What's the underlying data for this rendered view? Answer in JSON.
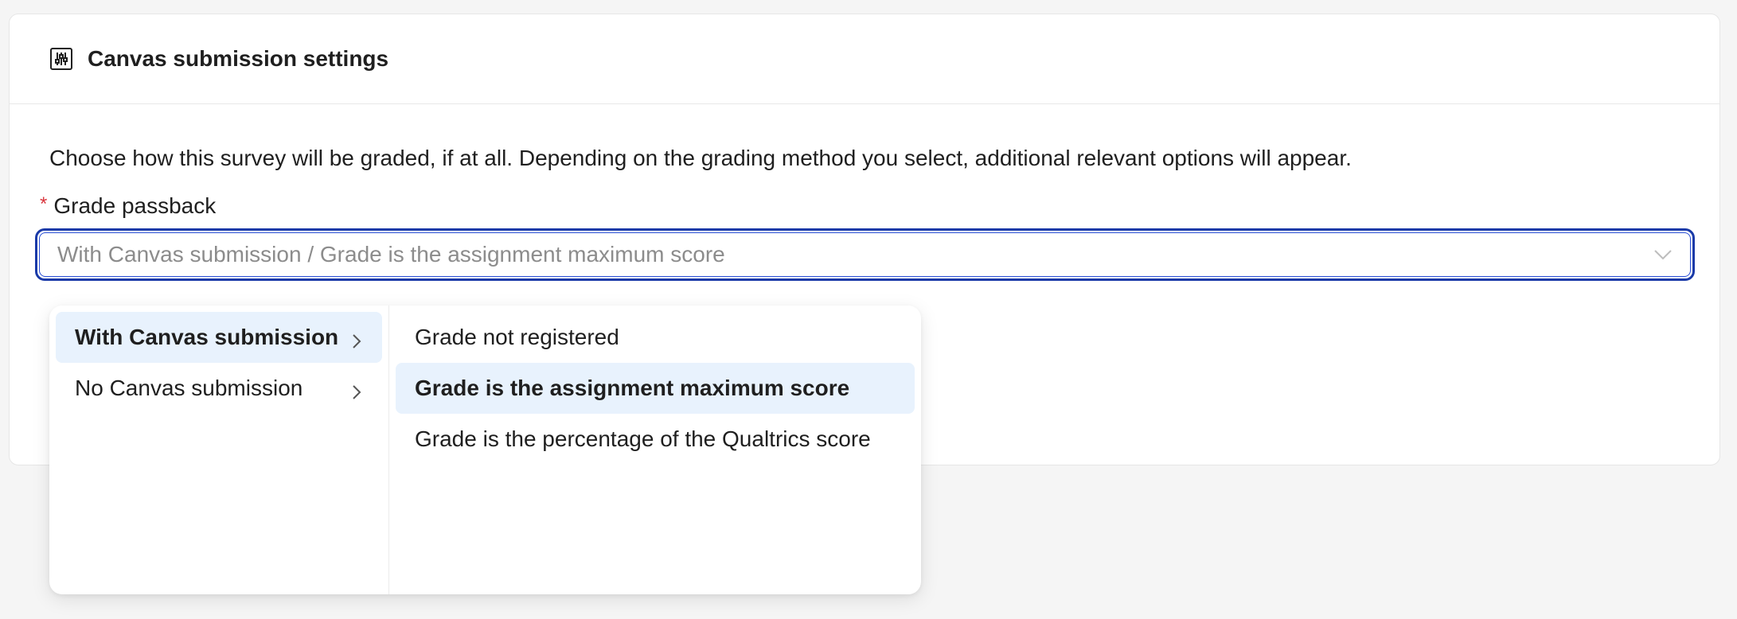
{
  "card": {
    "title": "Canvas submission settings",
    "icon": "sliders-icon",
    "description": "Choose how this survey will be graded, if at all. Depending on the grading method you select, additional relevant options will appear."
  },
  "field": {
    "required_mark": "*",
    "label": "Grade passback",
    "value": "With Canvas submission / Grade is the assignment maximum score",
    "chevron_icon": "chevron-down-icon"
  },
  "dropdown": {
    "level1": [
      {
        "label": "With Canvas submission",
        "selected": true
      },
      {
        "label": "No Canvas submission",
        "selected": false
      }
    ],
    "level2": [
      {
        "label": "Grade not registered",
        "selected": false
      },
      {
        "label": "Grade is the assignment maximum score",
        "selected": true
      },
      {
        "label": "Grade is the percentage of the Qualtrics score",
        "selected": false
      }
    ]
  },
  "colors": {
    "focus_border": "#1a3aa8",
    "selected_bg": "#e8f2fd",
    "required": "#d9363e"
  }
}
